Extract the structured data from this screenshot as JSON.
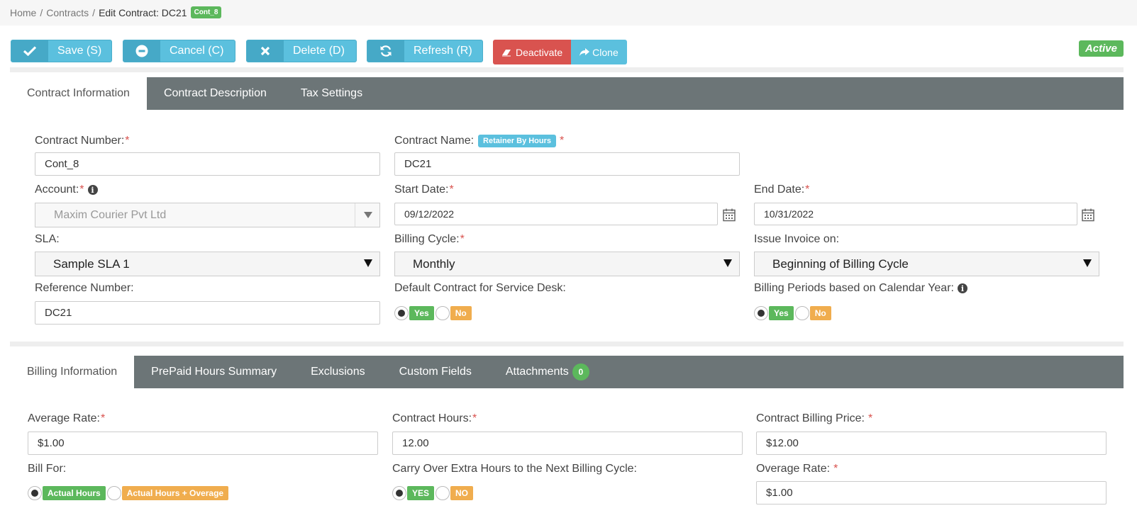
{
  "breadcrumb": {
    "home": "Home",
    "contracts": "Contracts",
    "current": "Edit Contract: DC21",
    "badge": "Cont_8"
  },
  "toolbar": {
    "save": "Save (S)",
    "cancel": "Cancel (C)",
    "delete": "Delete (D)",
    "refresh": "Refresh (R)",
    "deactivate": "Deactivate",
    "clone": "Clone",
    "status": "Active"
  },
  "tabs_top": [
    "Contract Information",
    "Contract Description",
    "Tax Settings"
  ],
  "contract": {
    "number_label": "Contract Number:",
    "number_value": "Cont_8",
    "name_label": "Contract Name:",
    "name_badge": "Retainer By Hours",
    "name_value": "DC21",
    "account_label": "Account:",
    "account_value": "Maxim Courier Pvt Ltd",
    "start_label": "Start Date:",
    "start_value": "09/12/2022",
    "end_label": "End Date:",
    "end_value": "10/31/2022",
    "sla_label": "SLA:",
    "sla_value": "Sample SLA 1",
    "billing_cycle_label": "Billing Cycle:",
    "billing_cycle_value": "Monthly",
    "issue_invoice_label": "Issue Invoice on:",
    "issue_invoice_value": "Beginning of Billing Cycle",
    "reference_label": "Reference Number:",
    "reference_value": "DC21",
    "default_contract_label": "Default Contract for Service Desk:",
    "default_contract_yes": "Yes",
    "default_contract_no": "No",
    "billing_periods_label": "Billing Periods based on Calendar Year:",
    "billing_periods_yes": "Yes",
    "billing_periods_no": "No",
    "required_mark": "*"
  },
  "tabs_bottom": [
    "Billing Information",
    "PrePaid Hours Summary",
    "Exclusions",
    "Custom Fields",
    "Attachments"
  ],
  "attachments_count": "0",
  "billing": {
    "avg_rate_label": "Average Rate:",
    "avg_rate_value": "$1.00",
    "hours_label": "Contract Hours:",
    "hours_value": "12.00",
    "price_label": "Contract Billing Price:",
    "price_value": "$12.00",
    "bill_for_label": "Bill For:",
    "bill_for_actual": "Actual Hours",
    "bill_for_overage": "Actual Hours + Overage",
    "carry_over_label": "Carry Over Extra Hours to the Next Billing Cycle:",
    "carry_over_yes": "YES",
    "carry_over_no": "NO",
    "overage_label": "Overage Rate:",
    "overage_value": "$1.00"
  },
  "colors": {
    "primary": "#5bc0de",
    "danger": "#d9534f",
    "success": "#5cb85c",
    "warning": "#f0ad4e",
    "tab_bar": "#6c7577"
  }
}
